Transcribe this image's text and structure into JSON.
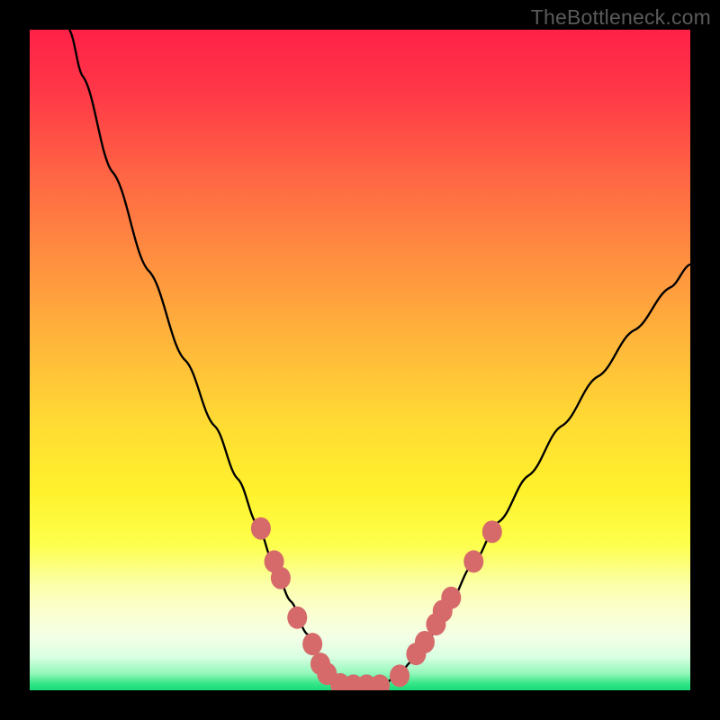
{
  "watermark": "TheBottleneck.com",
  "chart_data": {
    "type": "line",
    "title": "",
    "xlabel": "",
    "ylabel": "",
    "xlim": [
      0,
      100
    ],
    "ylim": [
      0,
      100
    ],
    "grid": false,
    "legend": false,
    "series": [
      {
        "name": "left-curve",
        "stroke": "#000000",
        "points": [
          {
            "x": 6.0,
            "y": 100.0
          },
          {
            "x": 8.0,
            "y": 93.0
          },
          {
            "x": 12.5,
            "y": 78.5
          },
          {
            "x": 18.0,
            "y": 63.5
          },
          {
            "x": 23.5,
            "y": 50.0
          },
          {
            "x": 28.0,
            "y": 40.0
          },
          {
            "x": 31.5,
            "y": 32.0
          },
          {
            "x": 34.5,
            "y": 25.0
          },
          {
            "x": 37.0,
            "y": 19.0
          },
          {
            "x": 39.5,
            "y": 13.5
          },
          {
            "x": 42.0,
            "y": 8.5
          },
          {
            "x": 44.0,
            "y": 4.5
          },
          {
            "x": 46.0,
            "y": 2.0
          },
          {
            "x": 48.0,
            "y": 0.6
          },
          {
            "x": 50.0,
            "y": 0.6
          }
        ]
      },
      {
        "name": "right-curve",
        "stroke": "#000000",
        "points": [
          {
            "x": 50.0,
            "y": 0.6
          },
          {
            "x": 53.0,
            "y": 0.6
          },
          {
            "x": 55.5,
            "y": 2.0
          },
          {
            "x": 58.0,
            "y": 4.5
          },
          {
            "x": 60.5,
            "y": 8.0
          },
          {
            "x": 63.5,
            "y": 13.0
          },
          {
            "x": 67.0,
            "y": 19.0
          },
          {
            "x": 71.0,
            "y": 25.5
          },
          {
            "x": 75.5,
            "y": 32.5
          },
          {
            "x": 80.5,
            "y": 40.0
          },
          {
            "x": 86.0,
            "y": 47.5
          },
          {
            "x": 91.5,
            "y": 54.5
          },
          {
            "x": 97.0,
            "y": 61.0
          },
          {
            "x": 100.0,
            "y": 64.5
          }
        ]
      },
      {
        "name": "marker-dots",
        "stroke": "#d66a6a",
        "fill": "#d66a6a",
        "marker": "circle",
        "points": [
          {
            "x": 35.0,
            "y": 24.5
          },
          {
            "x": 37.0,
            "y": 19.5
          },
          {
            "x": 38.0,
            "y": 17.0
          },
          {
            "x": 40.5,
            "y": 11.0
          },
          {
            "x": 42.8,
            "y": 7.0
          },
          {
            "x": 44.0,
            "y": 4.0
          },
          {
            "x": 45.0,
            "y": 2.5
          },
          {
            "x": 47.0,
            "y": 0.9
          },
          {
            "x": 49.0,
            "y": 0.7
          },
          {
            "x": 51.0,
            "y": 0.7
          },
          {
            "x": 53.0,
            "y": 0.7
          },
          {
            "x": 56.0,
            "y": 2.2
          },
          {
            "x": 58.5,
            "y": 5.5
          },
          {
            "x": 59.8,
            "y": 7.3
          },
          {
            "x": 61.5,
            "y": 10.0
          },
          {
            "x": 62.5,
            "y": 12.0
          },
          {
            "x": 63.8,
            "y": 14.0
          },
          {
            "x": 67.2,
            "y": 19.5
          },
          {
            "x": 70.0,
            "y": 24.0
          }
        ]
      }
    ],
    "colors": {
      "gradient_top": "#ff2048",
      "gradient_mid": "#ffe22f",
      "gradient_bottom": "#18db79",
      "curve": "#000000",
      "dots": "#d66a6a",
      "frame": "#000000"
    }
  }
}
